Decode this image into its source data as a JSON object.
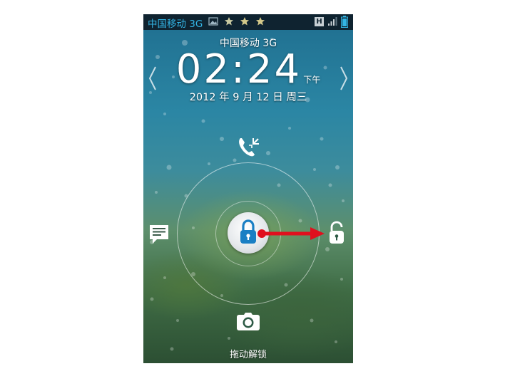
{
  "status_bar": {
    "carrier": "中国移动 3G",
    "network_type": "H",
    "icons": [
      "image-icon",
      "star-icon",
      "star-icon",
      "star-icon",
      "network-h-icon",
      "signal-icon",
      "battery-icon"
    ]
  },
  "lockscreen": {
    "carrier": "中国移动 3G",
    "time": "02:24",
    "ampm": "下午",
    "date": "2012 年 9 月 12 日 周三",
    "hint": "拖动解锁"
  },
  "targets": {
    "top": "missed-call-icon",
    "left": "message-icon",
    "right": "unlock-icon",
    "bottom": "camera-icon",
    "center": "lock-knob-icon"
  },
  "colors": {
    "accent_blue": "#33b5e5",
    "lock_blue": "#1a7fc4",
    "drag_arrow": "#e0101e"
  }
}
